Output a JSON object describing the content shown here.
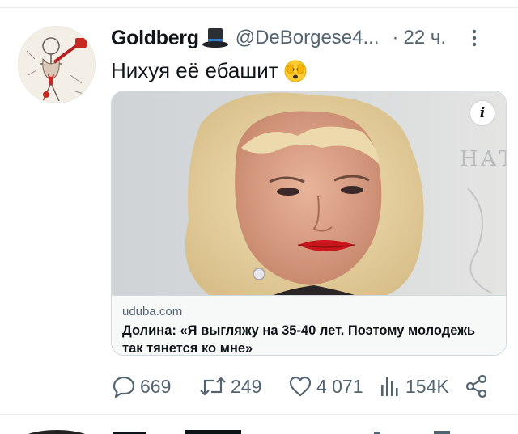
{
  "tweet": {
    "author_name": "Goldberg",
    "author_handle": "@DeBorgese4...",
    "separator": "·",
    "time": "22 ч.",
    "text": "Нихуя её ебашит",
    "icons": {
      "author_badge": "top-hat-icon",
      "text_emoji": "peeking-face-emoji-icon",
      "more": "more-options-icon"
    }
  },
  "card": {
    "domain": "uduba.com",
    "title": "Долина: «Я выгляжу на 35-40 лет. Поэтому молодежь так тянется ко мне»",
    "info_glyph": "i"
  },
  "actions": {
    "replies": "669",
    "retweets": "249",
    "likes": "4 071",
    "views": "154K"
  },
  "colors": {
    "text_primary": "#0f1419",
    "text_secondary": "#536471",
    "border": "#cfd9de"
  }
}
